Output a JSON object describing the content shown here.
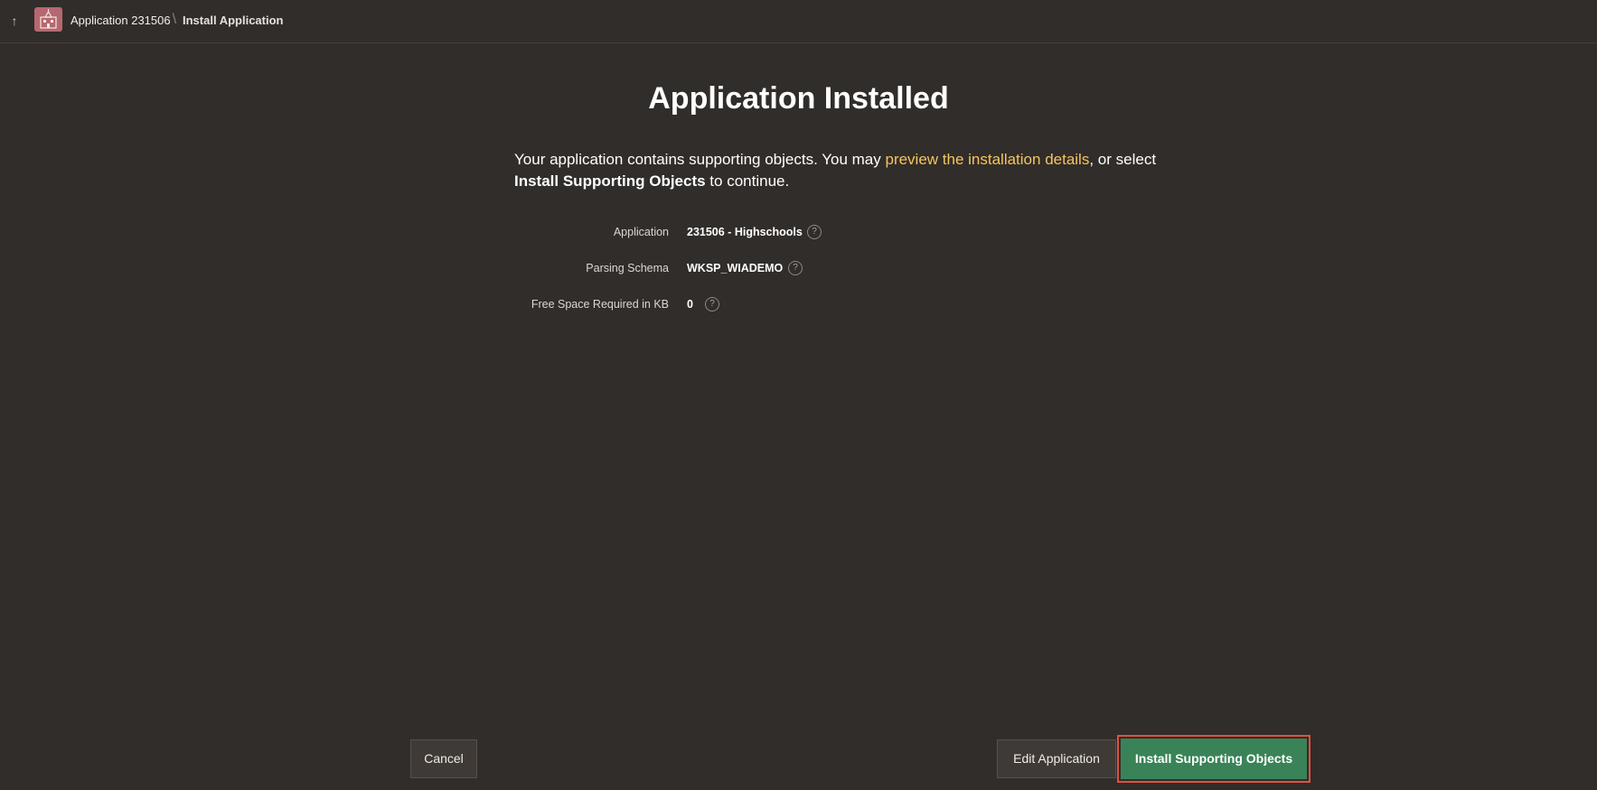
{
  "breadcrumb": {
    "app_label": "Application 231506",
    "separator": "\\",
    "current": "Install Application"
  },
  "icons": {
    "back": "up-arrow-icon",
    "app": "school-building-icon",
    "help": "help-circle-icon"
  },
  "page": {
    "title": "Application Installed",
    "intro_text_1": "Your application contains supporting objects. You may ",
    "intro_link": "preview the installation details",
    "intro_text_2": ", or select ",
    "intro_bold": "Install Supporting Objects",
    "intro_text_3": " to continue."
  },
  "details": {
    "application_label": "Application",
    "application_value": "231506 - Highschools",
    "schema_label": "Parsing Schema",
    "schema_value": "WKSP_WIADEMO",
    "space_label": "Free Space Required in KB",
    "space_value": "0",
    "help_glyph": "?"
  },
  "buttons": {
    "cancel": "Cancel",
    "edit": "Edit Application",
    "install": "Install Supporting Objects"
  },
  "colors": {
    "background": "#312d2a",
    "link": "#f5c560",
    "primary_button": "#3a8358",
    "highlight_border": "#e3503d",
    "app_icon": "#b5686f"
  }
}
